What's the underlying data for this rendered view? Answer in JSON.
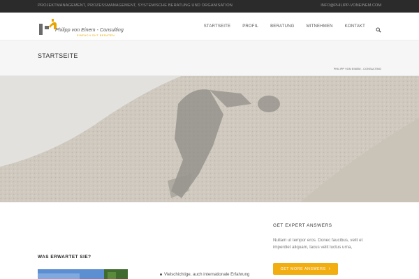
{
  "topbar": {
    "tagline": "Projektmanagement, Prozessmanagement, systemische Beratung und Organisation",
    "email": "info@philipp-voneinem.com"
  },
  "header": {
    "logo_name": "Philipp von Einem - Consulting",
    "logo_slogan": "EINFACH GUT BERATEN",
    "nav": [
      "Startseite",
      "Profil",
      "Beratung",
      "Mitnehmen",
      "Kontakt"
    ],
    "search_icon": "search-icon"
  },
  "titlebar": {
    "title": "Startseite",
    "breadcrumb": "Philipp von Einem - Consulting"
  },
  "content": {
    "heading": "Was erwartet Sie?",
    "bullet": "Vielschichtige, auch internationale Erfahrung"
  },
  "cta": {
    "title": "Get Expert Answers",
    "text": "Nullam ut tempor eros. Donec faucibus, velit et imperdiet aliquam, lacus velit luctus urna,",
    "button_label": "Get more answers",
    "button_color": "#f2ad11"
  },
  "colors": {
    "topbar": "#2b2b2b",
    "accent": "#f2ad11"
  }
}
